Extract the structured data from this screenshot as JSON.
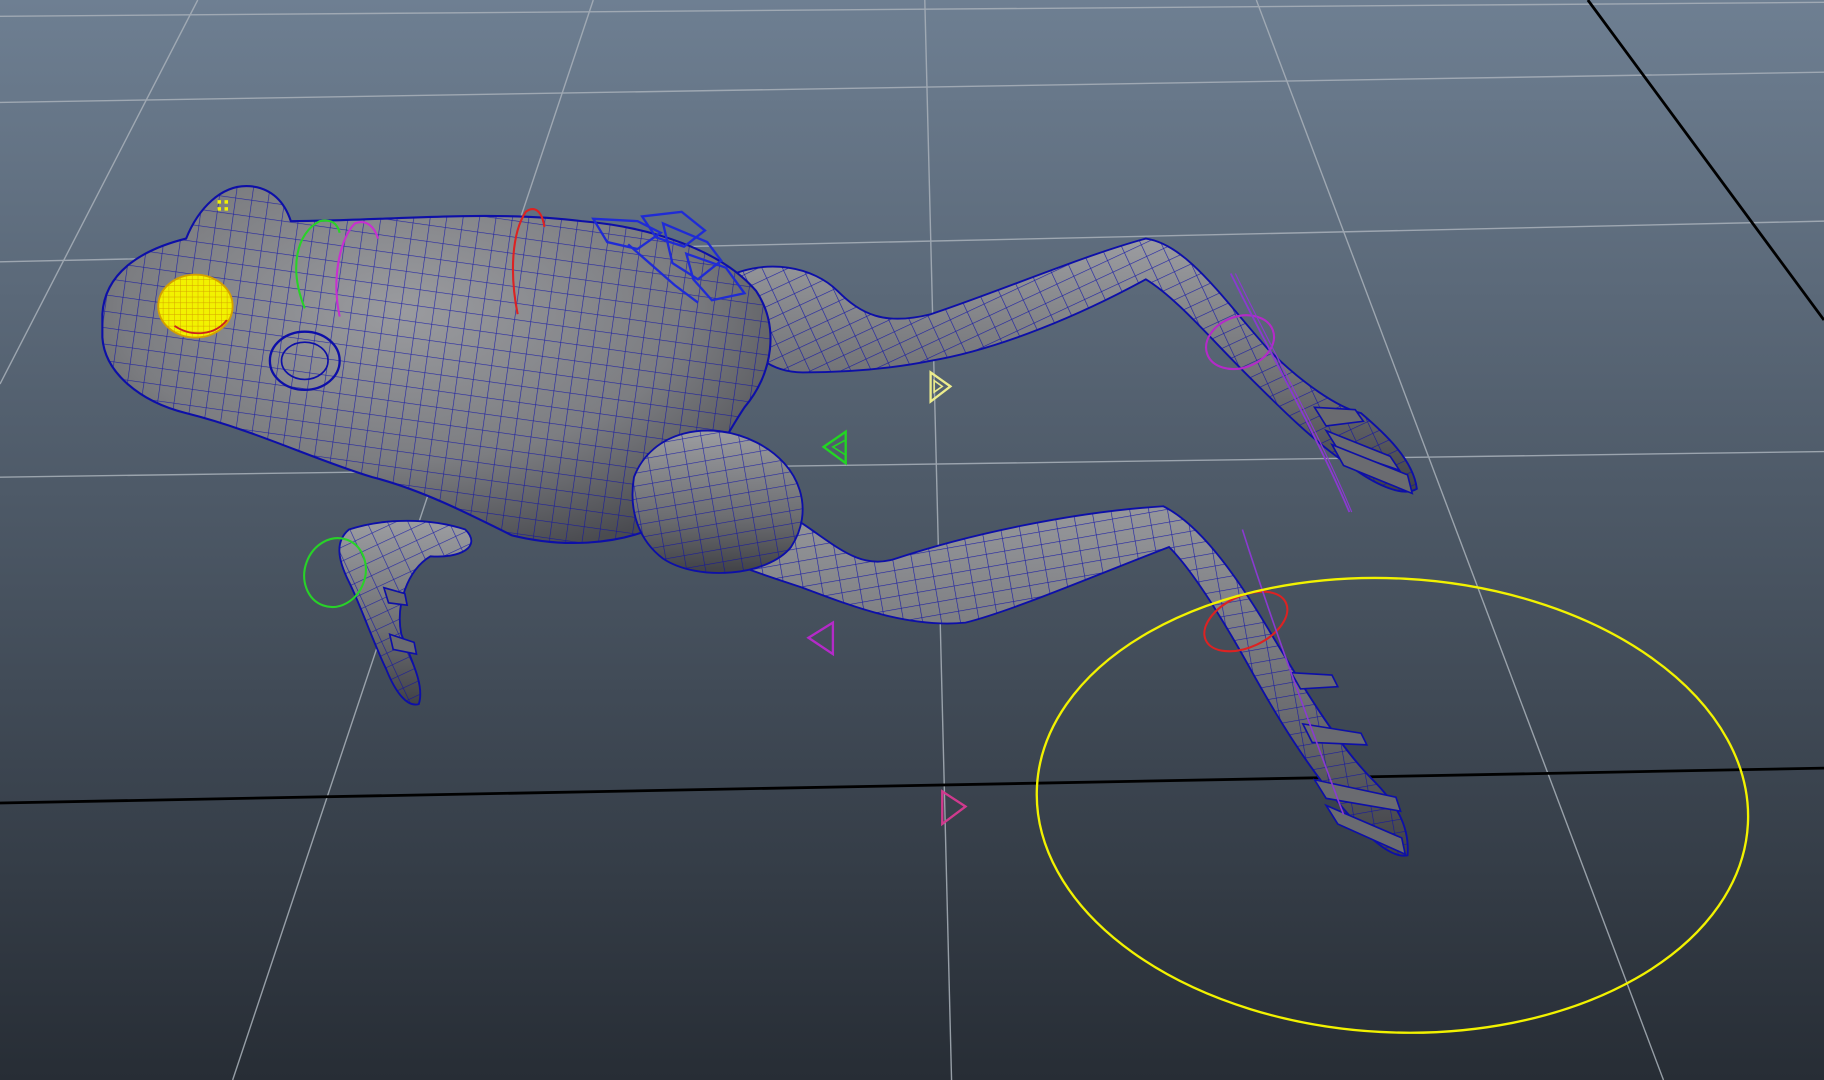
{
  "viewport": {
    "label": "",
    "colors": {
      "bg_top": "#6e7f92",
      "bg_bottom": "#272d35",
      "grid": "#a9b1ba",
      "axis": "#000000",
      "mesh_fill": "#7e7f83",
      "mesh_wire": "#0d0fa8",
      "selection_yellow": "#f2f200"
    }
  },
  "model": {
    "name": "frog",
    "display": "wireframe-on-shaded"
  },
  "controls": [
    {
      "name": "eye-selected",
      "color": "#f2f200"
    },
    {
      "name": "neck-ctrl",
      "color": "#28d228"
    },
    {
      "name": "head-ctrl",
      "color": "#c82fd0"
    },
    {
      "name": "spine-ctrl",
      "color": "#dd2222"
    },
    {
      "name": "spine-joints",
      "color": "#1f2bd6"
    },
    {
      "name": "front-arm-ctrl",
      "color": "#28d228"
    },
    {
      "name": "hip-pole-green",
      "color": "#22d622"
    },
    {
      "name": "knee-pole-yellow",
      "color": "#ecec8c"
    },
    {
      "name": "knee-pole-magenta",
      "color": "#b42ac8"
    },
    {
      "name": "knee-pole-pink",
      "color": "#d03a8e"
    },
    {
      "name": "back-foot-ctrl-upper",
      "color": "#b42ac8"
    },
    {
      "name": "back-foot-ctrl-lower",
      "color": "#dd2222"
    },
    {
      "name": "root-ctrl-selected",
      "color": "#f2f200"
    }
  ]
}
